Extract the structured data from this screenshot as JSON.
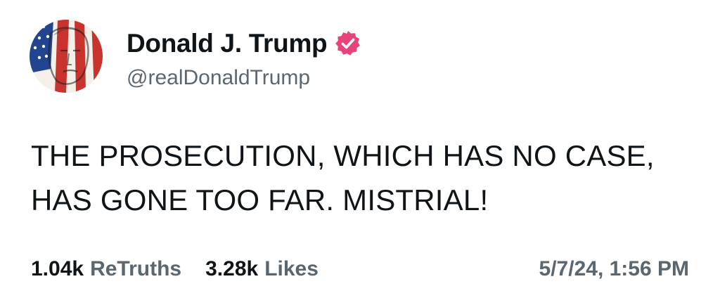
{
  "profile": {
    "display_name": "Donald J. Trump",
    "handle": "@realDonaldTrump",
    "verified": true,
    "verified_badge_color": "#e8447a",
    "avatar_icon": "flag-portrait-avatar"
  },
  "post": {
    "lines": [
      "THE PROSECUTION, WHICH HAS NO CASE,",
      "HAS GONE TOO FAR. MISTRIAL!"
    ]
  },
  "stats": {
    "retruths_count": "1.04k",
    "retruths_label": "ReTruths",
    "likes_count": "3.28k",
    "likes_label": "Likes"
  },
  "timestamp": "5/7/24, 1:56 PM",
  "colors": {
    "text_primary": "#0f1419",
    "text_secondary": "#5b6770",
    "background": "#ffffff"
  }
}
